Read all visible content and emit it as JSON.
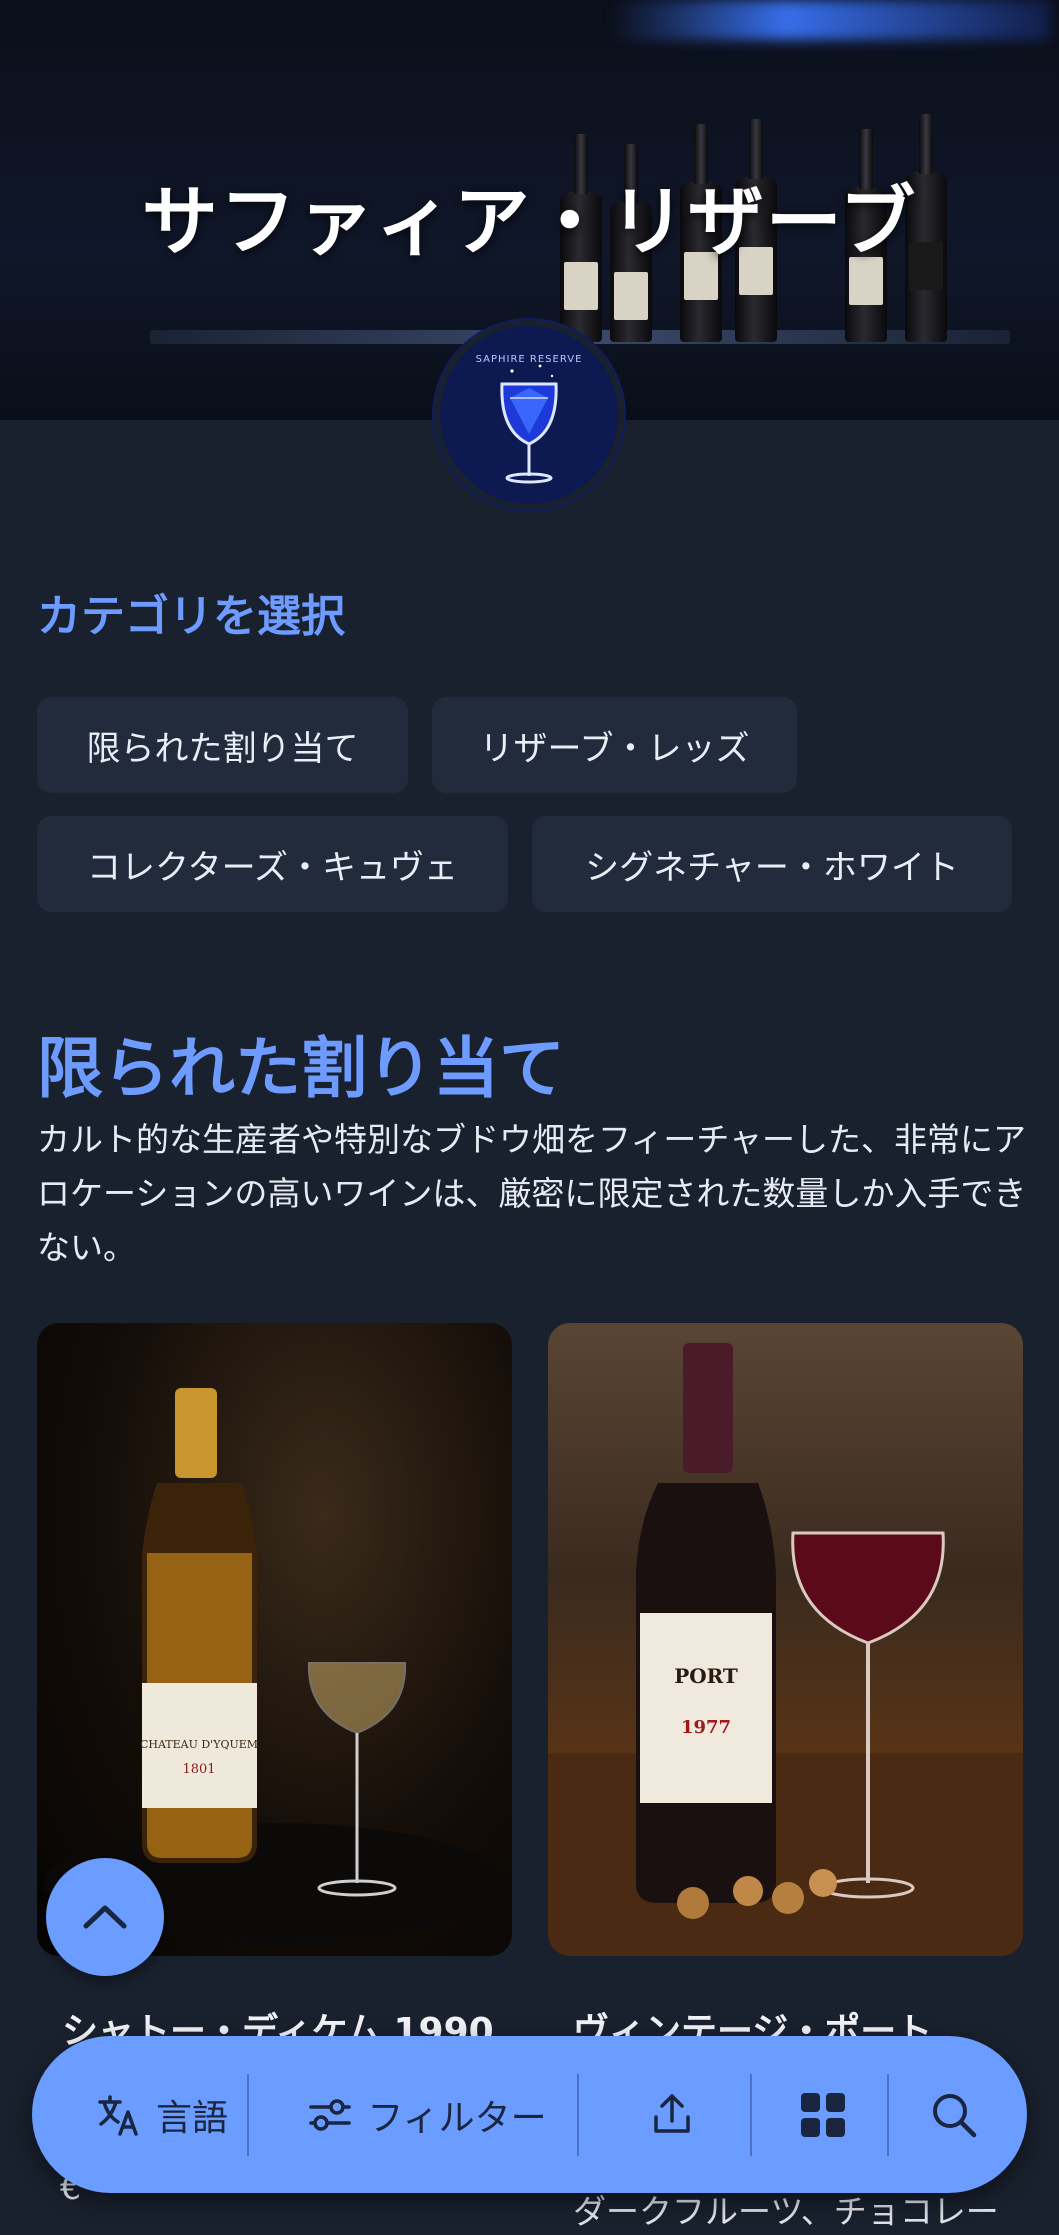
{
  "hero": {
    "title": "サファィア・リザーブ",
    "logo_text": "SAPHIRE RESERVE"
  },
  "category_select": {
    "heading": "カテゴリを選択",
    "chips": [
      {
        "label": "限られた割り当て"
      },
      {
        "label": "リザーブ・レッズ"
      },
      {
        "label": "コレクターズ・キュヴェ"
      },
      {
        "label": "シグネチャー・ホワイト"
      }
    ]
  },
  "category": {
    "title": "限られた割り当て",
    "description": "カルト的な生産者や特別なブドウ畑をフィーチャーした、非常にアロケーションの高いワインは、厳密に限定された数量しか入手できない。"
  },
  "products": [
    {
      "name": "シャトー・ディケム 1990",
      "bottle_label": "CHATEAU D'YQUEM",
      "bottle_year": "1801",
      "snippet": "€"
    },
    {
      "name": "ヴィンテージ・ポート",
      "bottle_label": "PORT",
      "bottle_year": "1977",
      "snippet": "ダークフルーツ、チョコレー"
    }
  ],
  "bottom_bar": {
    "language_label": "言語",
    "filter_label": "フィルター",
    "icons": [
      "translate-icon",
      "filter-icon",
      "share-icon",
      "grid-icon",
      "search-icon"
    ]
  },
  "colors": {
    "background": "#19212e",
    "accent": "#6d9bff",
    "chip_bg": "#212b3b",
    "bar": "#6b9cff"
  }
}
